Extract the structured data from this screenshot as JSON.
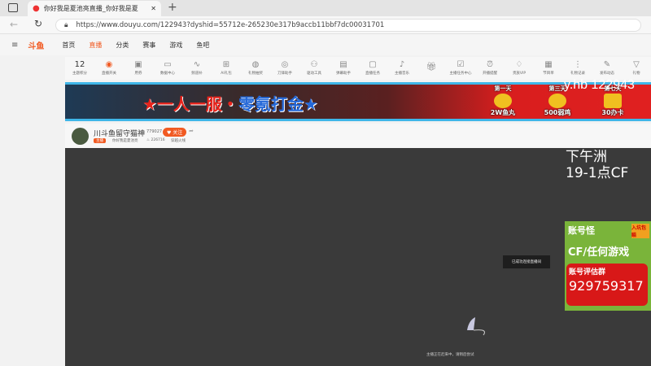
{
  "browser": {
    "tab_title": "你好我是夏池亮直播_你好我是夏",
    "url": "https://www.douyu.com/122943?dyshid=55712e-265230e317b9accb11bbf7dc00031701"
  },
  "site": {
    "logo": "斗鱼",
    "nav": [
      "首页",
      "直播",
      "分类",
      "赛事",
      "游戏",
      "鱼吧"
    ],
    "active_nav": "直播",
    "accent": "#f15a22"
  },
  "toolbar": {
    "level_num": "12",
    "items": [
      "主题积分",
      "直播开关",
      "用券",
      "数据中心",
      "频道补",
      "AI礼包",
      "礼物抽奖",
      "刀锋助手",
      "驱动工具",
      "弹幕助手",
      "直播任务",
      "主播音乐",
      "",
      "主播任务中心",
      "开播提醒",
      "贵族VIP",
      "节目单",
      "礼物记录",
      "发布动态",
      "礼物"
    ]
  },
  "banner": {
    "slogan_red": "★一人一服・",
    "slogan_blue": "零氪打金★",
    "prizes": [
      {
        "day": "第一天",
        "reward": "2W鱼丸"
      },
      {
        "day": "第三天",
        "reward": "500弱鸡"
      },
      {
        "day": "第七天",
        "reward": "30办卡"
      }
    ],
    "overlay": "y.hb 122943"
  },
  "streamer": {
    "name": "川斗鱼留守猫神",
    "id": "779027",
    "follow_label": "关注",
    "badge": "主播",
    "category": "你好我是夏池亮",
    "heat": "226716",
    "tag": "穿越火线"
  },
  "overlay": {
    "line1": "下午洲",
    "line2": "19-1点CF"
  },
  "ad": {
    "title": "账号怪",
    "corner": "入坑包赔",
    "line": "CF/任何游戏",
    "group_label": "账号评估群",
    "group_number": "929759317"
  },
  "player": {
    "toast": "已成功连接直播间",
    "loading_text": "主播正在赶来中，请稍后尝试"
  }
}
